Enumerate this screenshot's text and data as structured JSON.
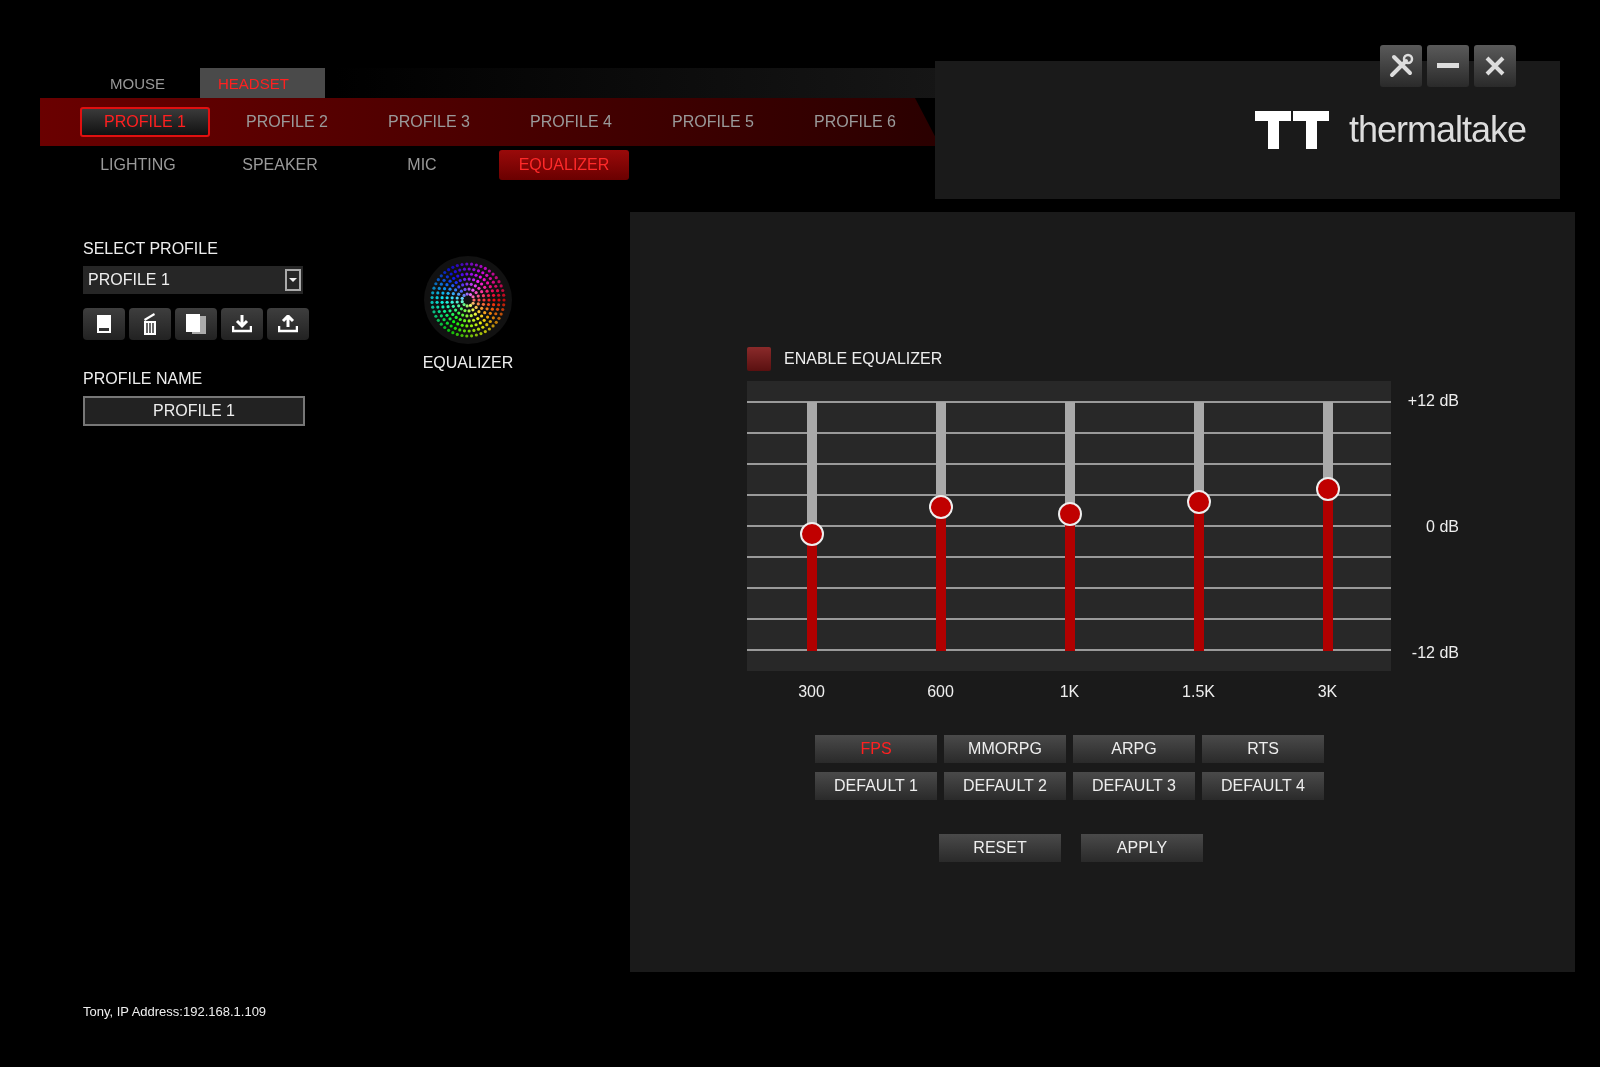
{
  "device_tabs": [
    {
      "label": "MOUSE",
      "selected": false
    },
    {
      "label": "HEADSET",
      "selected": true
    }
  ],
  "profile_tabs": [
    {
      "label": "PROFILE 1",
      "selected": true
    },
    {
      "label": "PROFILE 2",
      "selected": false
    },
    {
      "label": "PROFILE 3",
      "selected": false
    },
    {
      "label": "PROFILE 4",
      "selected": false
    },
    {
      "label": "PROFILE 5",
      "selected": false
    },
    {
      "label": "PROFILE 6",
      "selected": false
    }
  ],
  "section_tabs": [
    {
      "label": "LIGHTING",
      "selected": false
    },
    {
      "label": "SPEAKER",
      "selected": false
    },
    {
      "label": "MIC",
      "selected": false
    },
    {
      "label": "EQUALIZER",
      "selected": true
    }
  ],
  "brand": {
    "name": "thermaltake"
  },
  "select_profile": {
    "label": "SELECT PROFILE",
    "value": "PROFILE 1"
  },
  "profile_name": {
    "label": "PROFILE NAME",
    "value": "PROFILE 1"
  },
  "mode": {
    "label": "EQUALIZER"
  },
  "equalizer": {
    "enable": {
      "label": "ENABLE EQUALIZER",
      "checked": false
    },
    "scale": [
      "+12 dB",
      "0 dB",
      "-12 dB"
    ],
    "bands": [
      {
        "label": "300",
        "level": 0.47
      },
      {
        "label": "600",
        "level": 0.58
      },
      {
        "label": "1K",
        "level": 0.55
      },
      {
        "label": "1.5K",
        "level": 0.6
      },
      {
        "label": "3K",
        "level": 0.65
      }
    ],
    "presets": [
      {
        "label": "FPS",
        "selected": true
      },
      {
        "label": "MMORPG",
        "selected": false
      },
      {
        "label": "ARPG",
        "selected": false
      },
      {
        "label": "RTS",
        "selected": false
      },
      {
        "label": "DEFAULT 1",
        "selected": false
      },
      {
        "label": "DEFAULT 2",
        "selected": false
      },
      {
        "label": "DEFAULT 3",
        "selected": false
      },
      {
        "label": "DEFAULT 4",
        "selected": false
      }
    ],
    "actions": [
      "RESET",
      "APPLY"
    ]
  },
  "status": "Tony, IP Address:192.168.1.109"
}
